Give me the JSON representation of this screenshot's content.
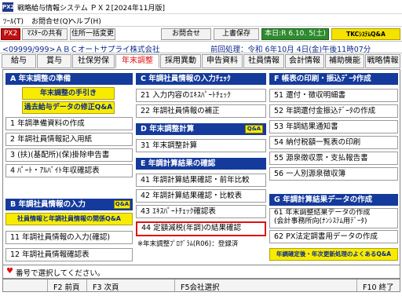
{
  "window": {
    "app_icon": "PX2",
    "title": "戦略給与情報システム ＰＸ２[2024年11月版]"
  },
  "menubar": [
    "ﾂｰﾙ(T)",
    "お問合せ(Q)",
    "ヘルプ(H)"
  ],
  "toolbar": {
    "px2": "PX2",
    "master_share": "ﾏｽﾀｰの共有",
    "address_change": "住所一括変更",
    "inquiry": "お問合せ",
    "overwrite_save": "上書保存",
    "date": "本日:R 6.10. 5(土)",
    "tkc_qa": "TKCｼｽﾃﾑQ&A"
  },
  "info": {
    "company": "<09999/999>ＡＢＣオートサプライ株式会社",
    "prev_process": "前回処理：令和 6年10月 4日(金)午後11時07分"
  },
  "tabs": [
    "給与",
    "賞与",
    "社保労保",
    "年末調整",
    "採用異動",
    "申告資料",
    "社員情報",
    "会計情報",
    "補助機能",
    "戦略情報"
  ],
  "active_tab": "年末調整",
  "colA": {
    "title": "A 年末調整の準備",
    "yellow1": "年末調整の手引き",
    "yellow2": "過去給与データの修正Q&A",
    "items": [
      "1 年調準備資料の作成",
      "2 年調社員情報記入用紙",
      "3 (扶)(基配所)(保)掛除申告書",
      "4 ﾊﾟｰﾄ・ｱﾙﾊﾞｲﾄ年収確認表"
    ]
  },
  "colB": {
    "title": "B 年調社員情報の入力",
    "qa": "Q&A",
    "yellow1": "社員情報と年調社員情報の関係Q&A",
    "items": [
      "11 年調社員情報の入力(確認)",
      "12 年調社員情報確認表"
    ]
  },
  "colC": {
    "title": "C 年調社員情報の入力ﾁｪｯｸ",
    "items": [
      "21 入力内容のｴｷｽﾊﾟｰﾄﾁｪｯｸ",
      "22 年調社員情報の補正"
    ]
  },
  "colD": {
    "title": "D 年末調整計算",
    "qa": "Q&A",
    "items": [
      "31 年末調整計算"
    ]
  },
  "colE": {
    "title": "E 年調計算結果の確認",
    "items": [
      "41 年調計算結果確認・前年比較",
      "42 年調計算結果確認・比較表",
      "43 ｴｷｽﾊﾟｰﾄﾁｪｯｸ確認表",
      "44 定額減税(年調)の結果確認"
    ],
    "note": "※年末調整ﾌﾟﾛｸﾞﾗﾑ(R06)：登録済"
  },
  "colF": {
    "title": "F 帳表の印刷・振込ﾃﾞｰﾀ作成",
    "items": [
      "51 還付・徴収明細書",
      "52 年調還付金振込ﾃﾞｰﾀの作成",
      "53 年調結果通知書",
      "54 納付税額一覧表の印刷",
      "55 源泉徴収票・支払報告書",
      "56 一人別源泉徴収簿"
    ]
  },
  "colG": {
    "title": "G 年調計算結果データの作成",
    "items": [
      "61 年末調整結果データの作成\n(会計事務所向(ﾅﾝｼｽﾃﾑ用ﾃﾞｰﾀ)",
      "62 PX法定調書用データの作成"
    ],
    "yellow": "年調確定後・年次更新処理のよくあるQ&A"
  },
  "notice": "番号で選択してください。",
  "fkeys": [
    "F2 前頁",
    "F3 次頁",
    "F5会社選択",
    "F10 終了"
  ]
}
